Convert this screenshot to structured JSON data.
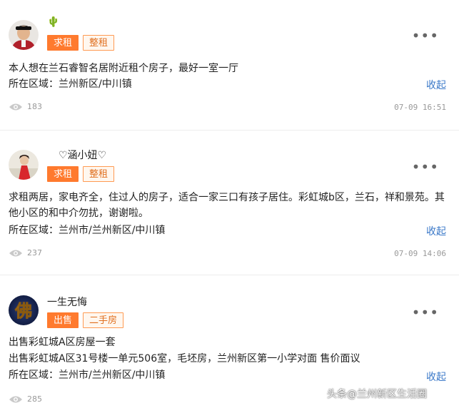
{
  "posts": [
    {
      "username": "🌵",
      "tags": [
        "求租",
        "整租"
      ],
      "text": "本人想在兰石睿智名居附近租个房子，最好一室一厅",
      "area_label": "所在区域：",
      "area": "兰州新区/中川镇",
      "collapse": "收起",
      "views": "183",
      "time": "07-09  16:51"
    },
    {
      "username": "♡涵小妞♡",
      "tags": [
        "求租",
        "整租"
      ],
      "text": "求租两居，家电齐全，住过人的房子，适合一家三口有孩子居住。彩虹城b区，兰石，祥和景苑。其他小区的和中介勿扰，谢谢啦。",
      "area_label": "所在区域：",
      "area": "兰州市/兰州新区/中川镇",
      "collapse": "收起",
      "views": "237",
      "time": "07-09  14:06"
    },
    {
      "username": "一生无悔",
      "tags": [
        "出售",
        "二手房"
      ],
      "text_line1": "出售彩虹城A区房屋一套",
      "text_line2": "出售彩虹城A区31号楼一单元506室，毛坯房，兰州新区第一小学对面 售价面议",
      "area_label": "所在区域：",
      "area": "兰州市/兰州新区/中川镇",
      "collapse": "收起",
      "views": "285",
      "avatar_char": "佛"
    }
  ],
  "more_icon": "⋮ more-dots",
  "watermark": {
    "platform": "头条",
    "sep": "@",
    "account": "兰州新区生活圈"
  },
  "colors": {
    "tag_solid": "#ff7a2e",
    "tag_outline": "#ff9a52",
    "link": "#3a78c8"
  }
}
